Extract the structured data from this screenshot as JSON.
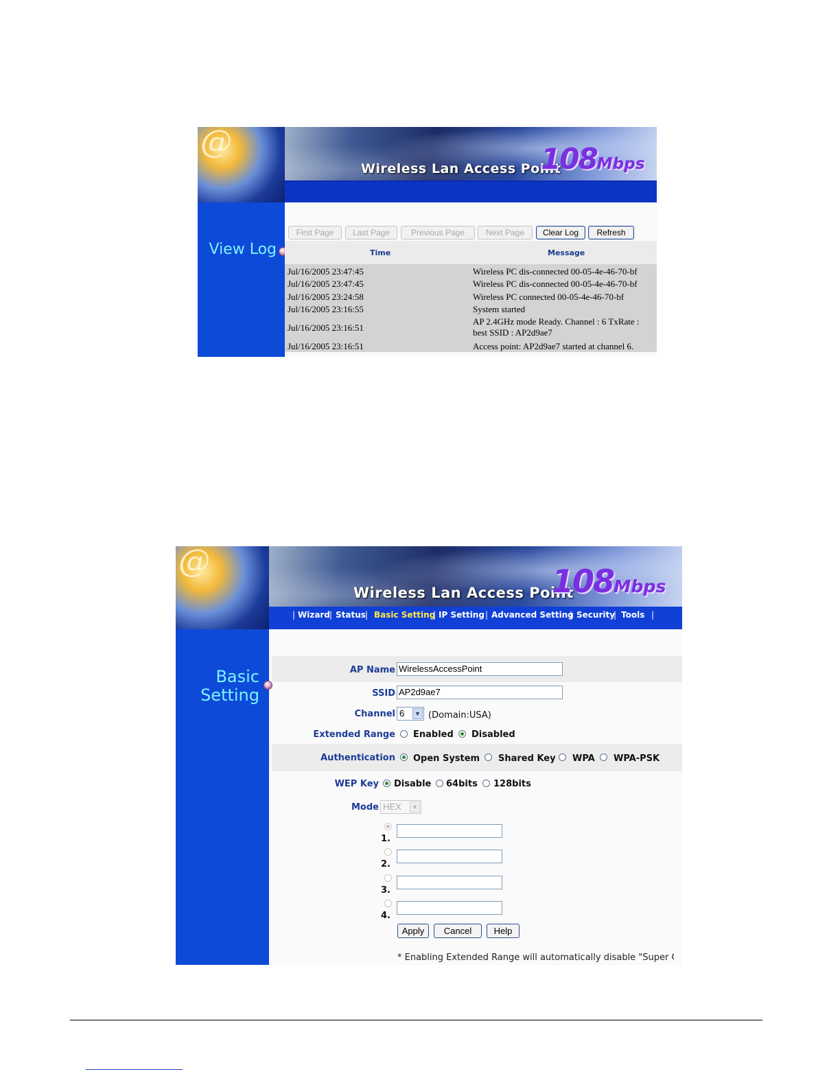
{
  "banner": {
    "title": "Wireless Lan Access Point",
    "speed_number": "108",
    "speed_unit": "Mbps",
    "logo_glyph": "@"
  },
  "view_log": {
    "page_title": "View Log",
    "buttons": {
      "first_page": "First Page",
      "last_page": "Last Page",
      "previous_page": "Previous Page",
      "next_page": "Next Page",
      "clear_log": "Clear Log",
      "refresh": "Refresh"
    },
    "columns": {
      "time": "Time",
      "message": "Message"
    },
    "rows": [
      {
        "time": "Jul/16/2005 23:47:45",
        "message": "Wireless PC dis-connected 00-05-4e-46-70-bf"
      },
      {
        "time": "Jul/16/2005 23:47:45",
        "message": "Wireless PC dis-connected 00-05-4e-46-70-bf"
      },
      {
        "time": "Jul/16/2005 23:24:58",
        "message": "Wireless PC connected 00-05-4e-46-70-bf"
      },
      {
        "time": "Jul/16/2005 23:16:55",
        "message": "System started"
      },
      {
        "time": "Jul/16/2005 23:16:51",
        "message": "AP 2.4GHz mode Ready. Channel : 6 TxRate : best SSID : AP2d9ae7"
      },
      {
        "time": "Jul/16/2005 23:16:51",
        "message": "Access point: AP2d9ae7 started at channel 6."
      }
    ]
  },
  "basic_setting": {
    "nav": {
      "wizard": "Wizard",
      "status": "Status",
      "basic_setting": "Basic  Setting",
      "ip_setting": "IP  Setting",
      "advanced_setting": "Advanced  Setting",
      "security": "Security",
      "tools": "Tools",
      "separator": "|"
    },
    "page_title_line1": "Basic",
    "page_title_line2": "Setting",
    "ap_name": {
      "label": "AP Name",
      "value": "WirelessAccessPoint"
    },
    "ssid": {
      "label": "SSID",
      "value": "AP2d9ae7"
    },
    "channel": {
      "label": "Channel",
      "value": "6",
      "domain": "(Domain:USA)"
    },
    "extended_range": {
      "label": "Extended Range",
      "enabled": "Enabled",
      "disabled": "Disabled",
      "selected": "Disabled"
    },
    "authentication": {
      "label": "Authentication",
      "options": [
        "Open System",
        "Shared Key",
        "WPA",
        "WPA-PSK"
      ],
      "selected": "Open System"
    },
    "wep_key": {
      "label": "WEP Key",
      "options": [
        "Disable",
        "64bits",
        "128bits"
      ],
      "selected": "Disable"
    },
    "mode": {
      "label": "Mode",
      "value": "HEX"
    },
    "keys": [
      {
        "number": "1.",
        "value": ""
      },
      {
        "number": "2.",
        "value": ""
      },
      {
        "number": "3.",
        "value": ""
      },
      {
        "number": "4.",
        "value": ""
      }
    ],
    "buttons": {
      "apply": "Apply",
      "cancel": "Cancel",
      "help": "Help"
    },
    "note": "* Enabling Extended Range will automatically disable \"Super G"
  }
}
